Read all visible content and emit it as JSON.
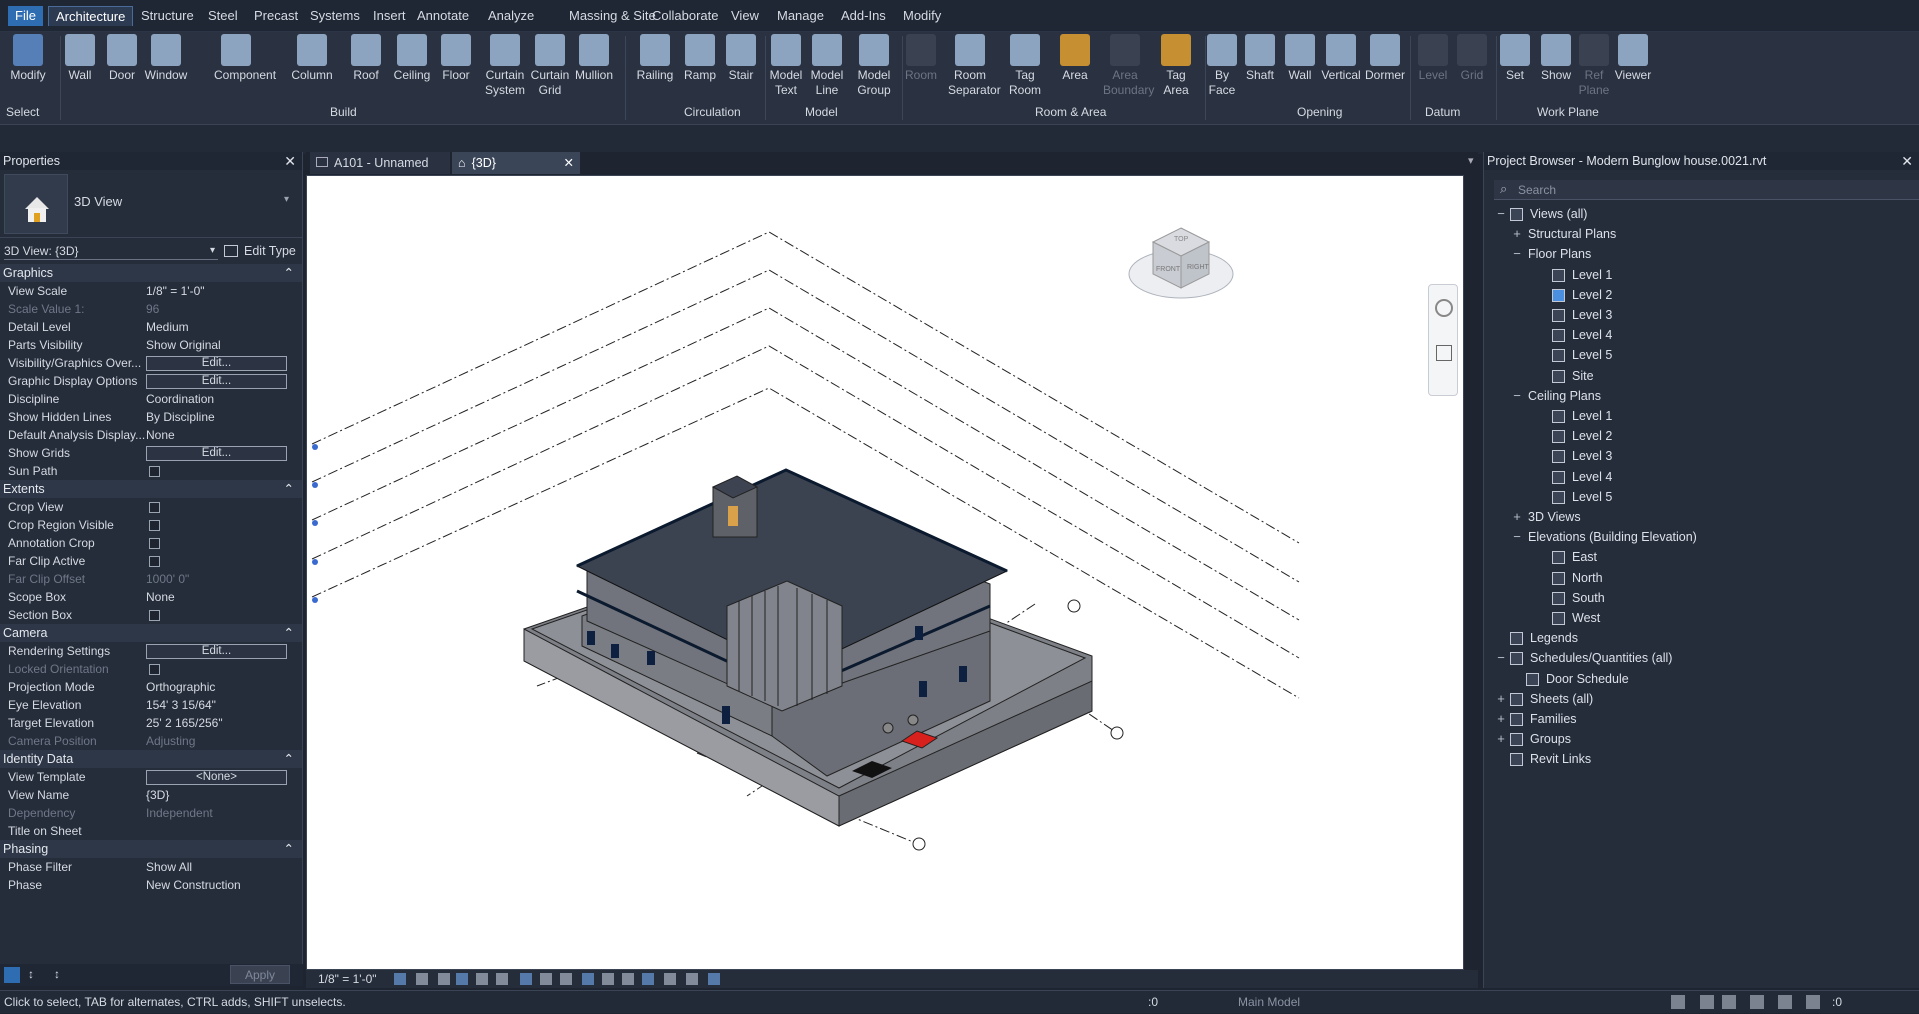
{
  "menu": {
    "tabs": [
      "File",
      "Architecture",
      "Structure",
      "Steel",
      "Precast",
      "Systems",
      "Insert",
      "Annotate",
      "Analyze",
      "Massing & Site",
      "Collaborate",
      "View",
      "Manage",
      "Add-Ins",
      "Modify"
    ],
    "active": "Architecture"
  },
  "ribbon": {
    "select": {
      "modify": "Modify",
      "select": "Select"
    },
    "build": {
      "label": "Build",
      "tools": [
        "Wall",
        "Door",
        "Window",
        "Component",
        "Column",
        "Roof",
        "Ceiling",
        "Floor",
        "Curtain\nSystem",
        "Curtain\nGrid",
        "Mullion"
      ]
    },
    "circulation": {
      "label": "Circulation",
      "tools": [
        "Railing",
        "Ramp",
        "Stair"
      ]
    },
    "model": {
      "label": "Model",
      "tools": [
        "Model\nText",
        "Model\nLine",
        "Model\nGroup"
      ]
    },
    "room": {
      "label": "Room & Area",
      "tools": [
        "Room",
        "Room\nSeparator",
        "Tag\nRoom",
        "Area",
        "Area\nBoundary",
        "Tag\nArea"
      ]
    },
    "opening": {
      "label": "Opening",
      "tools": [
        "By\nFace",
        "Shaft",
        "Wall",
        "Vertical",
        "Dormer"
      ]
    },
    "datum": {
      "label": "Datum",
      "tools": [
        "Level",
        "Grid"
      ]
    },
    "workplane": {
      "label": "Work Plane",
      "tools": [
        "Set",
        "Show",
        "Ref\nPlane",
        "Viewer"
      ]
    }
  },
  "properties": {
    "title": "Properties",
    "type_name": "3D View",
    "instance": "3D View: {3D}",
    "edit_type": "Edit Type",
    "apply": "Apply",
    "groups": [
      {
        "name": "Graphics",
        "rows": [
          {
            "k": "View Scale",
            "v": "1/8\" = 1'-0\""
          },
          {
            "k": "Scale Value    1:",
            "v": "96",
            "dim": true
          },
          {
            "k": "Detail Level",
            "v": "Medium"
          },
          {
            "k": "Parts Visibility",
            "v": "Show Original"
          },
          {
            "k": "Visibility/Graphics Over...",
            "v": "Edit...",
            "btn": true
          },
          {
            "k": "Graphic Display Options",
            "v": "Edit...",
            "btn": true
          },
          {
            "k": "Discipline",
            "v": "Coordination"
          },
          {
            "k": "Show Hidden Lines",
            "v": "By Discipline"
          },
          {
            "k": "Default Analysis Display...",
            "v": "None"
          },
          {
            "k": "Show Grids",
            "v": "Edit...",
            "btn": true
          },
          {
            "k": "Sun Path",
            "v": "",
            "chk": true
          }
        ]
      },
      {
        "name": "Extents",
        "rows": [
          {
            "k": "Crop View",
            "v": "",
            "chk": true
          },
          {
            "k": "Crop Region Visible",
            "v": "",
            "chk": true
          },
          {
            "k": "Annotation Crop",
            "v": "",
            "chk": true
          },
          {
            "k": "Far Clip Active",
            "v": "",
            "chk": true
          },
          {
            "k": "Far Clip Offset",
            "v": "1000'  0\"",
            "dim": true
          },
          {
            "k": "Scope Box",
            "v": "None"
          },
          {
            "k": "Section Box",
            "v": "",
            "chk": true
          }
        ]
      },
      {
        "name": "Camera",
        "rows": [
          {
            "k": "Rendering Settings",
            "v": "Edit...",
            "btn": true
          },
          {
            "k": "Locked Orientation",
            "v": "",
            "chk": true,
            "dim": true
          },
          {
            "k": "Projection Mode",
            "v": "Orthographic"
          },
          {
            "k": "Eye Elevation",
            "v": "154'  3 15/64\""
          },
          {
            "k": "Target Elevation",
            "v": "25'  2 165/256\""
          },
          {
            "k": "Camera Position",
            "v": "Adjusting",
            "dim": true
          }
        ]
      },
      {
        "name": "Identity Data",
        "rows": [
          {
            "k": "View Template",
            "v": "<None>",
            "btn": true
          },
          {
            "k": "View Name",
            "v": "{3D}"
          },
          {
            "k": "Dependency",
            "v": "Independent",
            "dim": true
          },
          {
            "k": "Title on Sheet",
            "v": ""
          }
        ]
      },
      {
        "name": "Phasing",
        "rows": [
          {
            "k": "Phase Filter",
            "v": "Show All"
          },
          {
            "k": "Phase",
            "v": "New Construction"
          }
        ]
      }
    ]
  },
  "view_tabs": [
    "A101 - Unnamed",
    "{3D}"
  ],
  "viewcube": {
    "top": "TOP",
    "front": "FRONT",
    "right": "RIGHT"
  },
  "view_bar": {
    "scale": "1/8\" = 1'-0\""
  },
  "browser": {
    "title": "Project Browser - Modern Bunglow house.0021.rvt",
    "search_placeholder": "Search",
    "items": [
      {
        "label": "Views (all)",
        "level": 0,
        "exp": "−"
      },
      {
        "label": "Structural Plans",
        "level": 1,
        "exp": "+"
      },
      {
        "label": "Floor Plans",
        "level": 1,
        "exp": "−"
      },
      {
        "label": "Level 1",
        "level": 2
      },
      {
        "label": "Level 2",
        "level": 2,
        "sel": true
      },
      {
        "label": "Level 3",
        "level": 2
      },
      {
        "label": "Level 4",
        "level": 2
      },
      {
        "label": "Level 5",
        "level": 2
      },
      {
        "label": "Site",
        "level": 2
      },
      {
        "label": "Ceiling Plans",
        "level": 1,
        "exp": "−"
      },
      {
        "label": "Level 1",
        "level": 2
      },
      {
        "label": "Level 2",
        "level": 2
      },
      {
        "label": "Level 3",
        "level": 2
      },
      {
        "label": "Level 4",
        "level": 2
      },
      {
        "label": "Level 5",
        "level": 2
      },
      {
        "label": "3D Views",
        "level": 1,
        "exp": "+"
      },
      {
        "label": "Elevations (Building Elevation)",
        "level": 1,
        "exp": "−"
      },
      {
        "label": "East",
        "level": 2
      },
      {
        "label": "North",
        "level": 2
      },
      {
        "label": "South",
        "level": 2
      },
      {
        "label": "West",
        "level": 2
      },
      {
        "label": "Legends",
        "level": 0
      },
      {
        "label": "Schedules/Quantities (all)",
        "level": 0,
        "exp": "−"
      },
      {
        "label": "Door Schedule",
        "level": 1
      },
      {
        "label": "Sheets (all)",
        "level": 0,
        "exp": "+"
      },
      {
        "label": "Families",
        "level": 0,
        "exp": "+"
      },
      {
        "label": "Groups",
        "level": 0,
        "exp": "+"
      },
      {
        "label": "Revit Links",
        "level": 0
      }
    ]
  },
  "status": {
    "message": "Click to select, TAB for alternates, CTRL adds, SHIFT unselects.",
    "worksets": ":0",
    "model": "Main Model",
    "filter": ":0"
  }
}
